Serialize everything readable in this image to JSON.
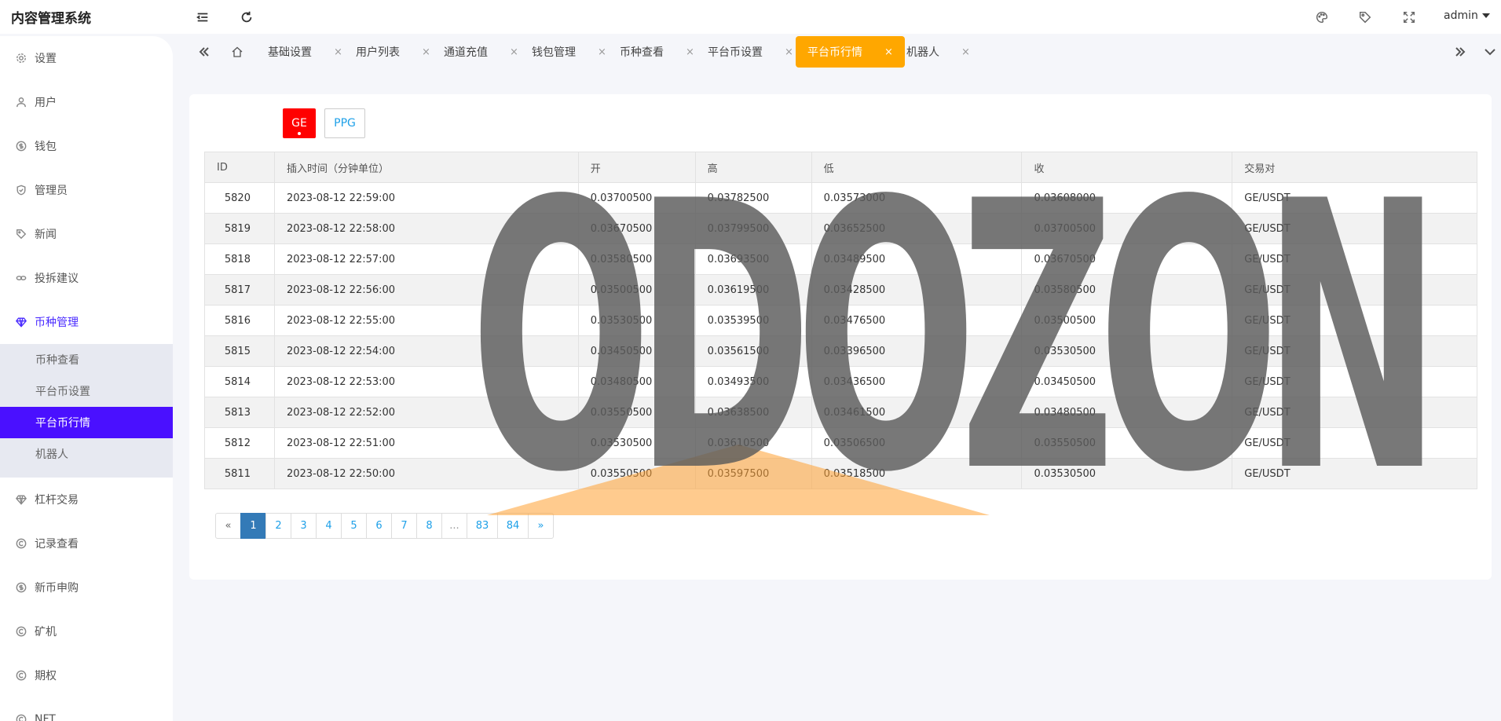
{
  "app": {
    "title": "内容管理系统"
  },
  "header": {
    "user": "admin",
    "icons": [
      "menu-fold-icon",
      "refresh-icon",
      "palette-icon",
      "tag-icon",
      "fullscreen-icon"
    ]
  },
  "sidebar": {
    "items": [
      {
        "label": "设置",
        "icon": "gear-icon"
      },
      {
        "label": "用户",
        "icon": "user-icon"
      },
      {
        "label": "钱包",
        "icon": "coin-icon"
      },
      {
        "label": "管理员",
        "icon": "shield-icon"
      },
      {
        "label": "新闻",
        "icon": "tag-icon"
      },
      {
        "label": "投拆建议",
        "icon": "link-icon"
      },
      {
        "label": "币种管理",
        "icon": "diamond-icon"
      },
      {
        "label": "杠杆交易",
        "icon": "diamond-icon"
      },
      {
        "label": "记录查看",
        "icon": "circle-c-icon"
      },
      {
        "label": "新币申购",
        "icon": "coin-icon"
      },
      {
        "label": "矿机",
        "icon": "circle-c-icon"
      },
      {
        "label": "期权",
        "icon": "circle-c-icon"
      },
      {
        "label": "NFT",
        "icon": "circle-c-icon"
      }
    ],
    "submenu": [
      {
        "label": "币种查看"
      },
      {
        "label": "平台币设置"
      },
      {
        "label": "平台币行情"
      },
      {
        "label": "机器人"
      }
    ]
  },
  "tabs": [
    {
      "label": "基础设置"
    },
    {
      "label": "用户列表"
    },
    {
      "label": "通道充值"
    },
    {
      "label": "钱包管理"
    },
    {
      "label": "币种查看"
    },
    {
      "label": "平台币设置"
    },
    {
      "label": "平台币行情"
    },
    {
      "label": "机器人"
    }
  ],
  "tab_close": "×",
  "symbols": {
    "ge": "GE",
    "ppg": "PPG"
  },
  "table": {
    "headers": [
      "ID",
      "插入时间（分钟单位）",
      "开",
      "高",
      "低",
      "收",
      "交易对"
    ],
    "rows": [
      [
        "5820",
        "2023-08-12 22:59:00",
        "0.03700500",
        "0.03782500",
        "0.03573000",
        "0.03608000",
        "GE/USDT"
      ],
      [
        "5819",
        "2023-08-12 22:58:00",
        "0.03670500",
        "0.03799500",
        "0.03652500",
        "0.03700500",
        "GE/USDT"
      ],
      [
        "5818",
        "2023-08-12 22:57:00",
        "0.03580500",
        "0.03693500",
        "0.03489500",
        "0.03670500",
        "GE/USDT"
      ],
      [
        "5817",
        "2023-08-12 22:56:00",
        "0.03500500",
        "0.03619500",
        "0.03428500",
        "0.03580500",
        "GE/USDT"
      ],
      [
        "5816",
        "2023-08-12 22:55:00",
        "0.03530500",
        "0.03539500",
        "0.03476500",
        "0.03500500",
        "GE/USDT"
      ],
      [
        "5815",
        "2023-08-12 22:54:00",
        "0.03450500",
        "0.03561500",
        "0.03396500",
        "0.03530500",
        "GE/USDT"
      ],
      [
        "5814",
        "2023-08-12 22:53:00",
        "0.03480500",
        "0.03493500",
        "0.03436500",
        "0.03450500",
        "GE/USDT"
      ],
      [
        "5813",
        "2023-08-12 22:52:00",
        "0.03550500",
        "0.03638500",
        "0.03461500",
        "0.03480500",
        "GE/USDT"
      ],
      [
        "5812",
        "2023-08-12 22:51:00",
        "0.03530500",
        "0.03610500",
        "0.03506500",
        "0.03550500",
        "GE/USDT"
      ],
      [
        "5811",
        "2023-08-12 22:50:00",
        "0.03550500",
        "0.03597500",
        "0.03518500",
        "0.03530500",
        "GE/USDT"
      ]
    ]
  },
  "pagination": {
    "prev": "«",
    "pages": [
      "1",
      "2",
      "3",
      "4",
      "5",
      "6",
      "7",
      "8"
    ],
    "ellipsis": "...",
    "tail": [
      "83",
      "84"
    ],
    "next": "»",
    "current": "1"
  },
  "watermark": {
    "text": "ODOZON"
  },
  "colors": {
    "accent": "#4a10ff",
    "active_tab": "#ffa700",
    "symbol_active": "#ff0000",
    "pager_active": "#337ab7",
    "link": "#1ea0e8"
  }
}
